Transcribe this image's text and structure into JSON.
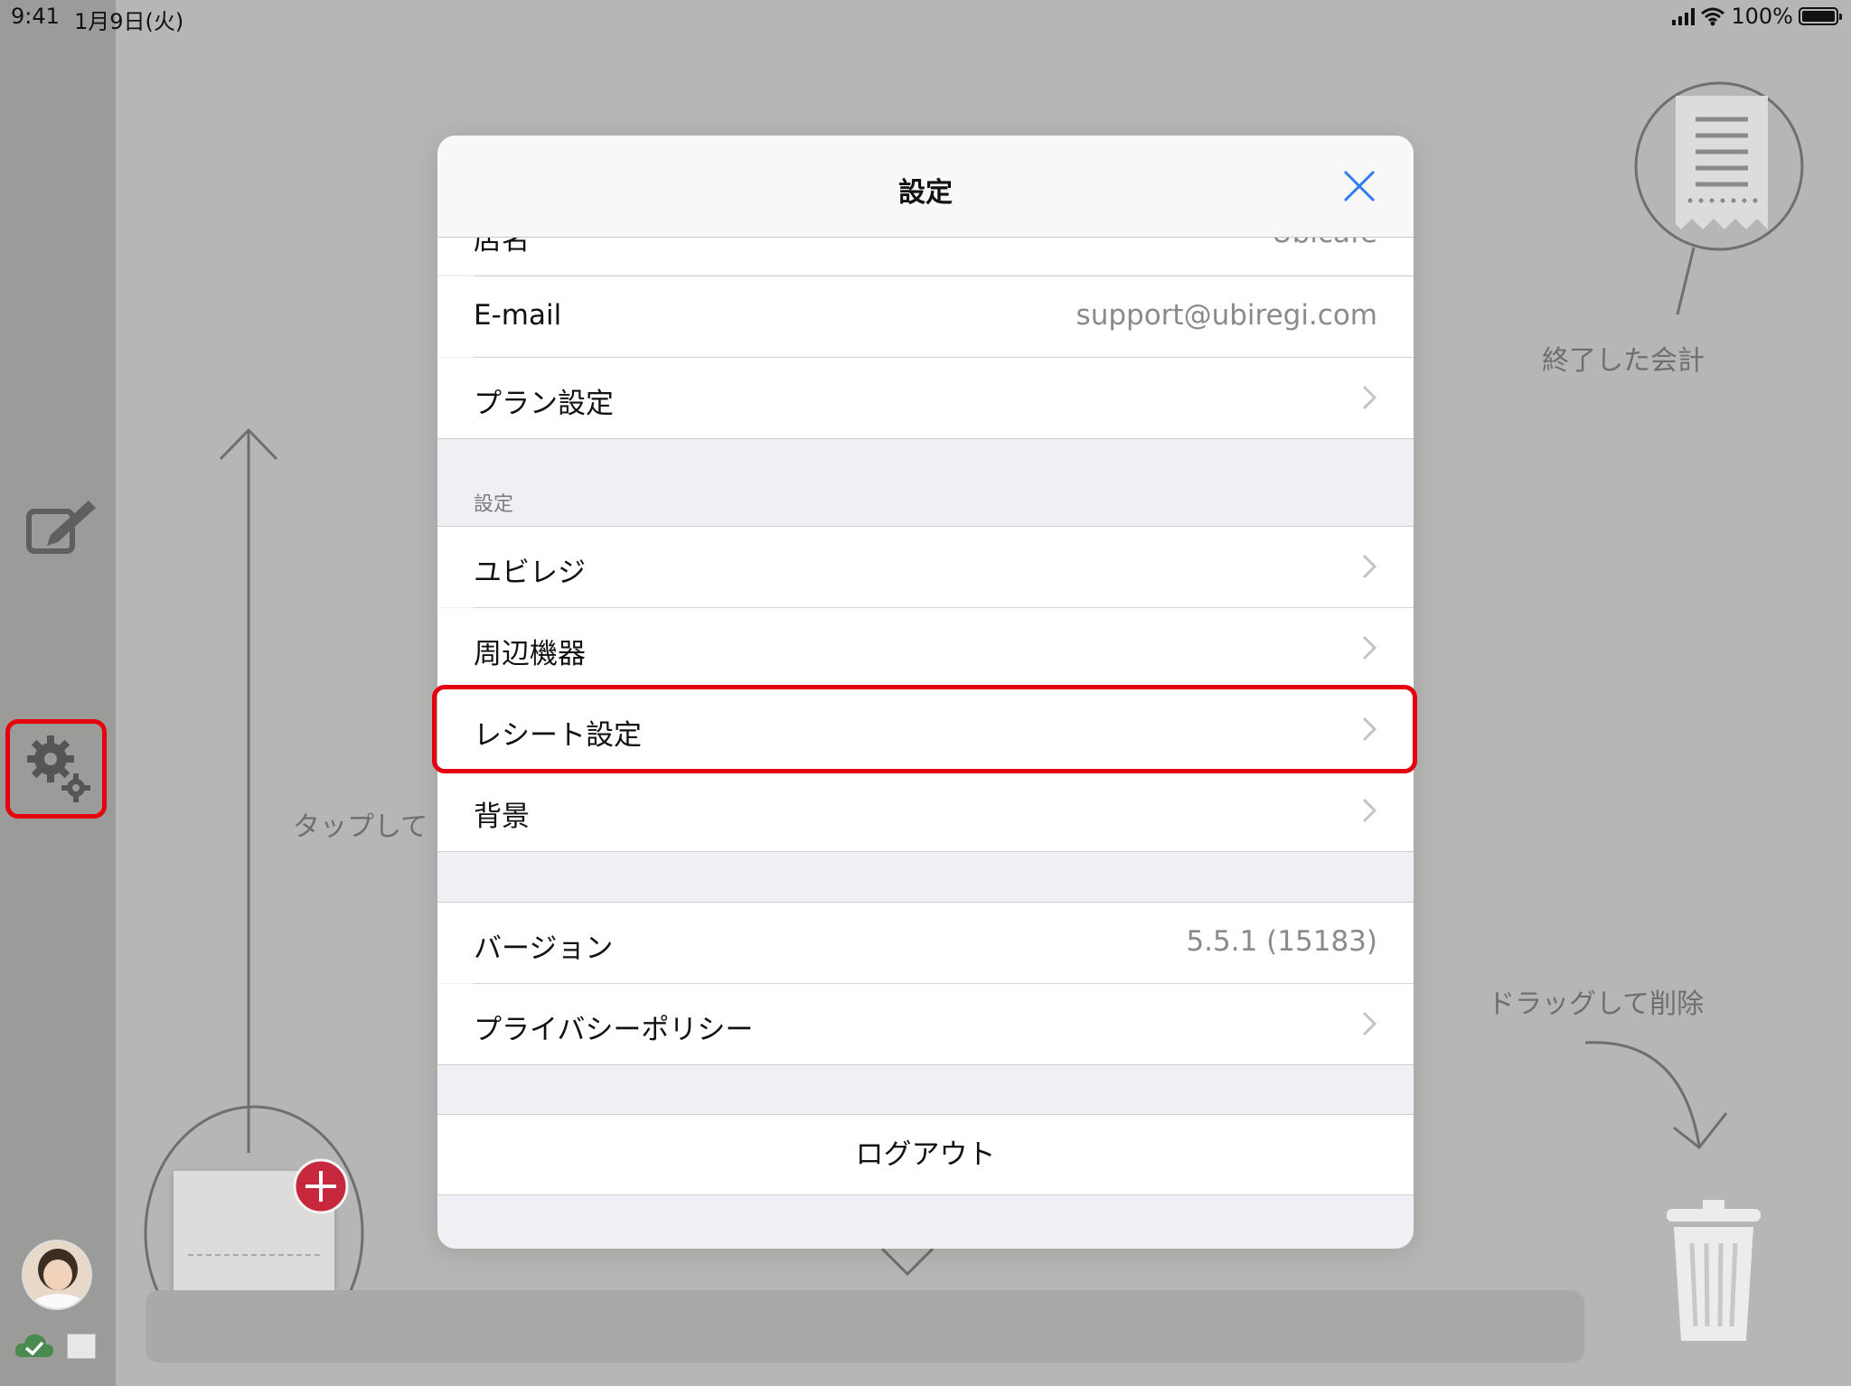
{
  "status": {
    "time": "9:41",
    "date": "1月9日(火)",
    "battery": "100%"
  },
  "background": {
    "finished_label": "終了した会計",
    "tap_label": "タップして",
    "drag_label": "ドラッグして削除"
  },
  "modal": {
    "title": "設定",
    "rows_top": [
      {
        "label": "店名",
        "value": "Ubicafe"
      },
      {
        "label": "E-mail",
        "value": "support@ubiregi.com"
      },
      {
        "label": "プラン設定"
      }
    ],
    "section_header": "設定",
    "settings_rows": [
      {
        "label": "ユビレジ"
      },
      {
        "label": "周辺機器"
      },
      {
        "label": "レシート設定"
      },
      {
        "label": "背景"
      }
    ],
    "info_rows": [
      {
        "label": "バージョン",
        "value": "5.5.1 (15183)"
      },
      {
        "label": "プライバシーポリシー"
      }
    ],
    "logout_label": "ログアウト"
  }
}
